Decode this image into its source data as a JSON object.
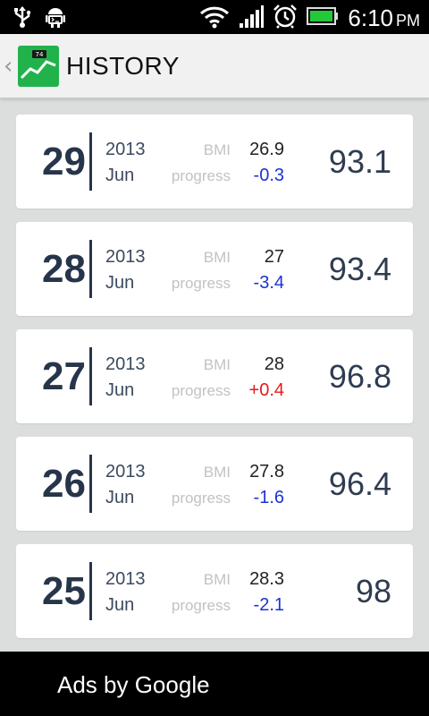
{
  "status_bar": {
    "time": "6:10",
    "ampm": "PM",
    "icons": [
      "usb-icon",
      "android-debug-icon",
      "wifi-icon",
      "signal-icon",
      "alarm-icon",
      "battery-icon"
    ]
  },
  "action_bar": {
    "title": "HISTORY",
    "logo_badge": "74",
    "icons": [
      "back-chevron-icon",
      "app-logo-icon"
    ]
  },
  "colors": {
    "accent_green": "#22b24c",
    "dark_text": "#27354a",
    "negative_progress": "#1a33d6",
    "positive_progress": "#e31b1b"
  },
  "labels": {
    "bmi": "BMI",
    "progress": "progress"
  },
  "entries": [
    {
      "day": "29",
      "year": "2013",
      "month": "Jun",
      "bmi": "26.9",
      "progress": "-0.3",
      "progress_color": "#1a33d6",
      "weight": "93.1"
    },
    {
      "day": "28",
      "year": "2013",
      "month": "Jun",
      "bmi": "27",
      "progress": "-3.4",
      "progress_color": "#1a33d6",
      "weight": "93.4"
    },
    {
      "day": "27",
      "year": "2013",
      "month": "Jun",
      "bmi": "28",
      "progress": "+0.4",
      "progress_color": "#e31b1b",
      "weight": "96.8"
    },
    {
      "day": "26",
      "year": "2013",
      "month": "Jun",
      "bmi": "27.8",
      "progress": "-1.6",
      "progress_color": "#1a33d6",
      "weight": "96.4"
    },
    {
      "day": "25",
      "year": "2013",
      "month": "Jun",
      "bmi": "28.3",
      "progress": "-2.1",
      "progress_color": "#1a33d6",
      "weight": "98"
    }
  ],
  "ad_bar": {
    "text": "Ads by Google"
  }
}
